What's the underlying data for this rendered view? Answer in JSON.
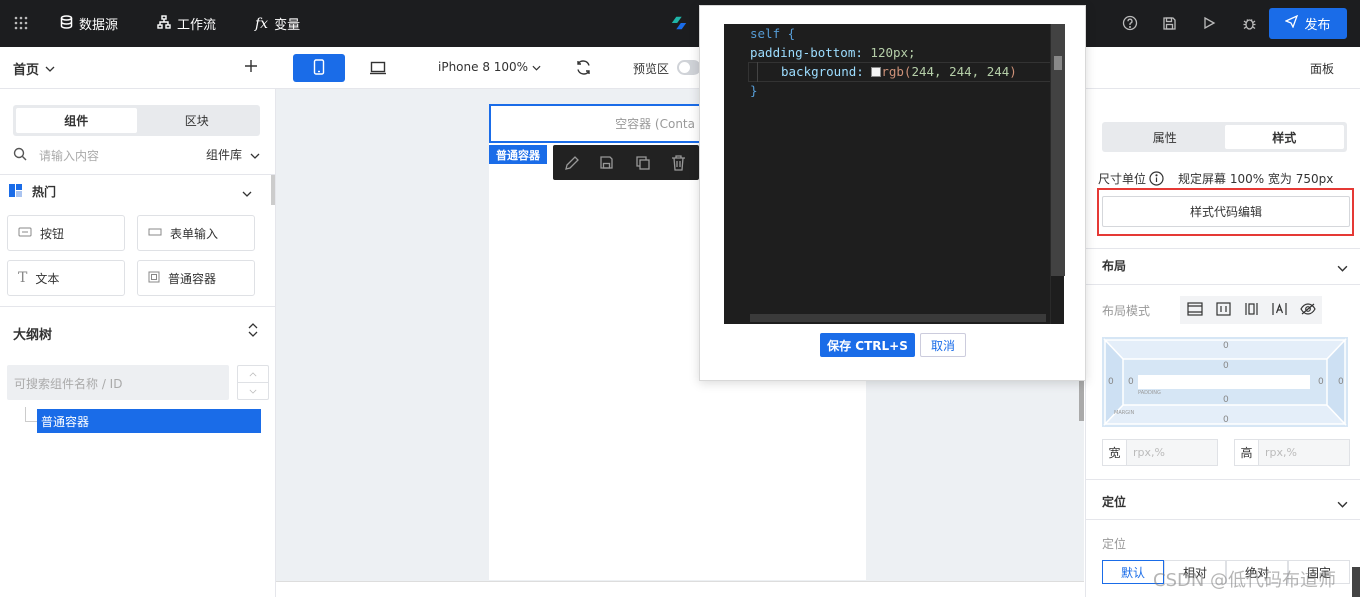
{
  "topbar": {
    "datasource": "数据源",
    "workflow": "工作流",
    "variables": "变量",
    "publish": "发布"
  },
  "subbar": {
    "page": "首页",
    "device": "iPhone 8 100%",
    "preview": "预览区",
    "panel": "面板"
  },
  "left": {
    "tabs": [
      "组件",
      "区块"
    ],
    "search_placeholder": "请输入内容",
    "library": "组件库",
    "hot": "热门",
    "components": [
      "按钮",
      "表单输入",
      "文本",
      "普通容器"
    ],
    "outline_title": "大纲树",
    "outline_search_placeholder": "可搜索组件名称 / ID",
    "outline_item": "普通容器"
  },
  "canvas": {
    "empty_container": "空容器 (Conta",
    "selected_tag": "普通容器"
  },
  "modal": {
    "code": {
      "l1": "self {",
      "l2_prop": "padding-bottom:",
      "l2_val": "120px;",
      "l3_prop": "background:",
      "l3_fn": "rgb(",
      "l3_val": "244, 244, 244",
      "l3_end": ")",
      "l4": "}"
    },
    "save": "保存 CTRL+S",
    "cancel": "取消"
  },
  "right": {
    "tabs": [
      "属性",
      "样式"
    ],
    "unit_label": "尺寸单位",
    "unit_value": "规定屏幕 100% 宽为 750px",
    "style_code_button": "样式代码编辑",
    "layout_title": "布局",
    "layout_mode_label": "布局模式",
    "box_values": [
      "0",
      "0",
      "0",
      "0",
      "0",
      "0",
      "0",
      "0"
    ],
    "padding_label": "PADDING",
    "margin_label": "MARGIN",
    "width_label": "宽",
    "width_placeholder": "rpx,%",
    "height_label": "高",
    "height_placeholder": "rpx,%",
    "position_title": "定位",
    "position_label": "定位",
    "position_options": [
      "默认",
      "相对",
      "绝对",
      "固定"
    ]
  },
  "watermark": "CSDN @低代码布道师",
  "colors": {
    "topbar": "#1c1d1f",
    "primary": "#1a6ce8",
    "highlight_border": "#e53935"
  }
}
